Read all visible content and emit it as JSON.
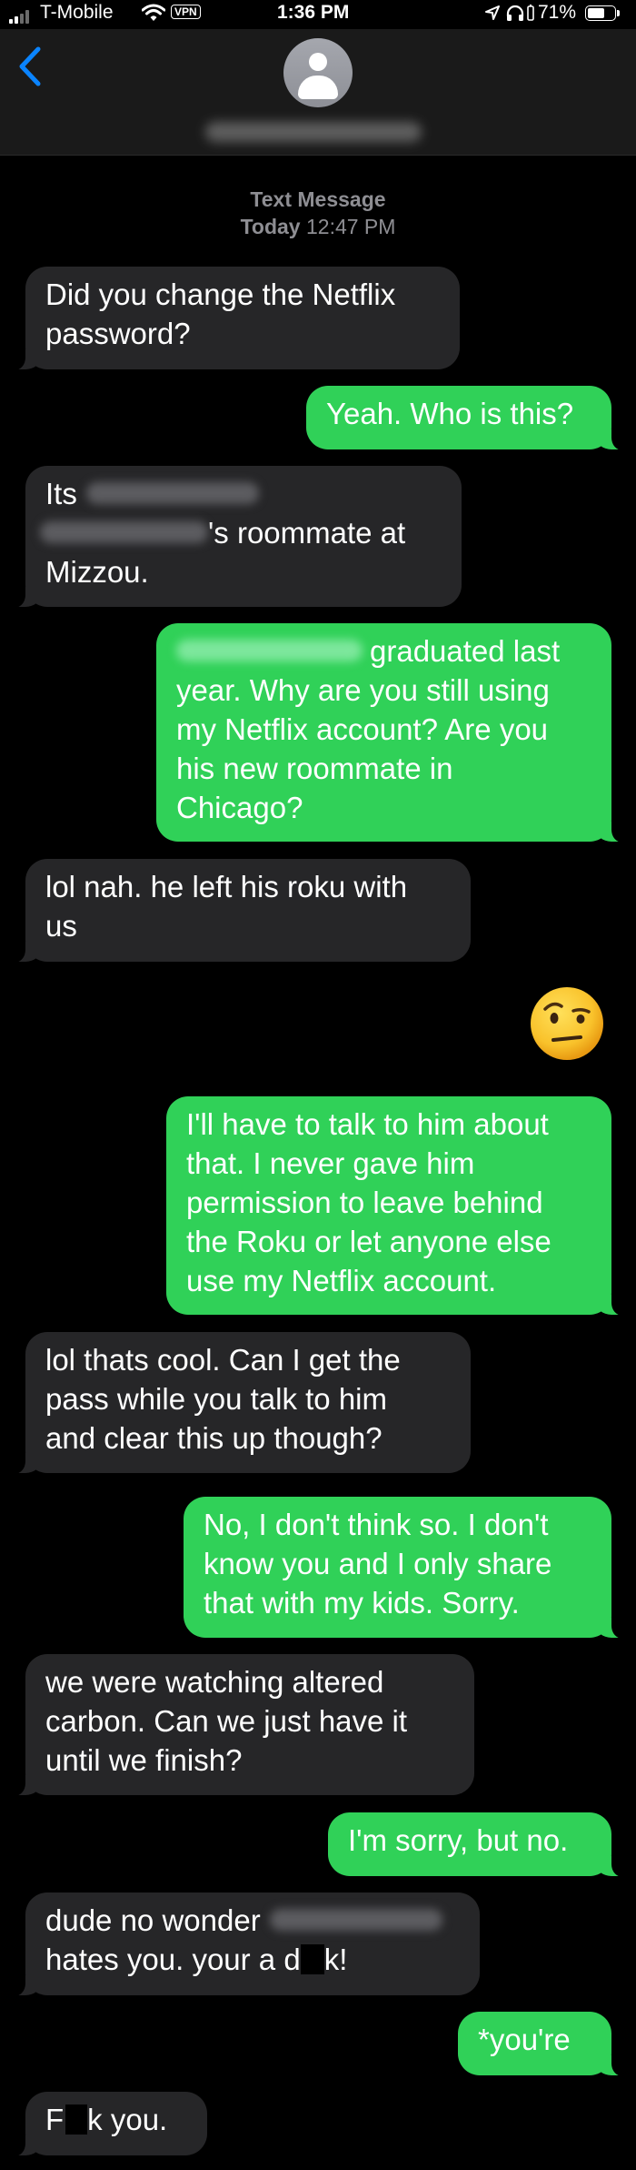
{
  "status_bar": {
    "carrier": "T-Mobile",
    "vpn": "VPN",
    "time": "1:36 PM",
    "battery_percent": "71%",
    "battery_level": 0.71
  },
  "header": {
    "back_icon": "chevron-left-icon",
    "avatar_icon": "person-icon"
  },
  "thread": {
    "type_label": "Text Message",
    "day": "Today",
    "time": "12:47 PM"
  },
  "messages": [
    {
      "from": "them",
      "lines": [
        "Did you change the Netflix",
        "password?"
      ]
    },
    {
      "from": "me",
      "lines": [
        "Yeah. Who is this?"
      ]
    },
    {
      "from": "them",
      "lines": [
        "Its",
        "'s roommate at",
        "Mizzou."
      ]
    },
    {
      "from": "me",
      "lines": [
        "graduated last",
        "year. Why are you still using",
        "my Netflix account? Are you",
        "his new roommate in",
        "Chicago?"
      ]
    },
    {
      "from": "them",
      "lines": [
        "lol nah. he left his roku with",
        "us"
      ]
    },
    {
      "from": "me",
      "emoji": "raised-eyebrow-emoji"
    },
    {
      "from": "me",
      "lines": [
        "I'll have to talk to him about",
        "that. I never gave him",
        "permission to leave behind",
        "the Roku or let anyone else",
        "use my Netflix account."
      ]
    },
    {
      "from": "them",
      "lines": [
        "lol thats cool.  Can I get the",
        "pass while you talk to him",
        "and clear this up though?"
      ]
    },
    {
      "from": "me",
      "lines": [
        "No, I don't think so. I don't",
        "know you and I only share",
        "that with my kids. Sorry."
      ]
    },
    {
      "from": "them",
      "lines": [
        "we were watching altered",
        "carbon.  Can we just have it",
        "until we finish?"
      ]
    },
    {
      "from": "me",
      "lines": [
        "I'm sorry, but no."
      ]
    },
    {
      "from": "them",
      "lines": [
        "dude no wonder",
        "hates you. your a d",
        "k!"
      ]
    },
    {
      "from": "me",
      "lines": [
        "*you're"
      ]
    },
    {
      "from": "them",
      "lines": [
        "F",
        "k you."
      ]
    }
  ],
  "colors": {
    "incoming_bubble": "#262628",
    "outgoing_bubble": "#30d158",
    "accent": "#0a84ff"
  }
}
